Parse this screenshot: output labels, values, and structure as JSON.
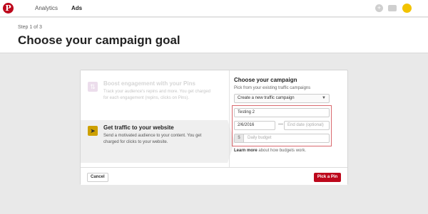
{
  "nav": {
    "logo": "P",
    "links": [
      "Analytics",
      "Ads"
    ],
    "icons": [
      "plus-icon",
      "message-icon",
      "bell-icon"
    ],
    "brand_color": "#bd081c"
  },
  "header": {
    "step": "Step 1 of 3",
    "title": "Choose your campaign goal"
  },
  "goals": [
    {
      "title": "Boost engagement with your Pins",
      "desc": "Track your audience's repins and more. You get charged for each engagement (repins, clicks on Pins).",
      "icon": "pin-icon"
    },
    {
      "title": "Get traffic to your website",
      "desc": "Send a motivated audience to your content. You get charged for clicks to your website.",
      "icon": "cursor-icon"
    }
  ],
  "campaign": {
    "title": "Choose your campaign",
    "subtitle": "Pick from your existing traffic campaigns",
    "select_value": "Create a new traffic campaign",
    "name_value": "Testing 2",
    "start_date": "2/6/2016",
    "end_date_placeholder": "End date (optional)",
    "budget_placeholder": "Daily budget",
    "currency": "$",
    "learn_more": "Learn more",
    "learn_more_rest": " about how budgets work."
  },
  "footer": {
    "cancel_label": "Cancel",
    "submit_label": "Pick a Pin"
  }
}
